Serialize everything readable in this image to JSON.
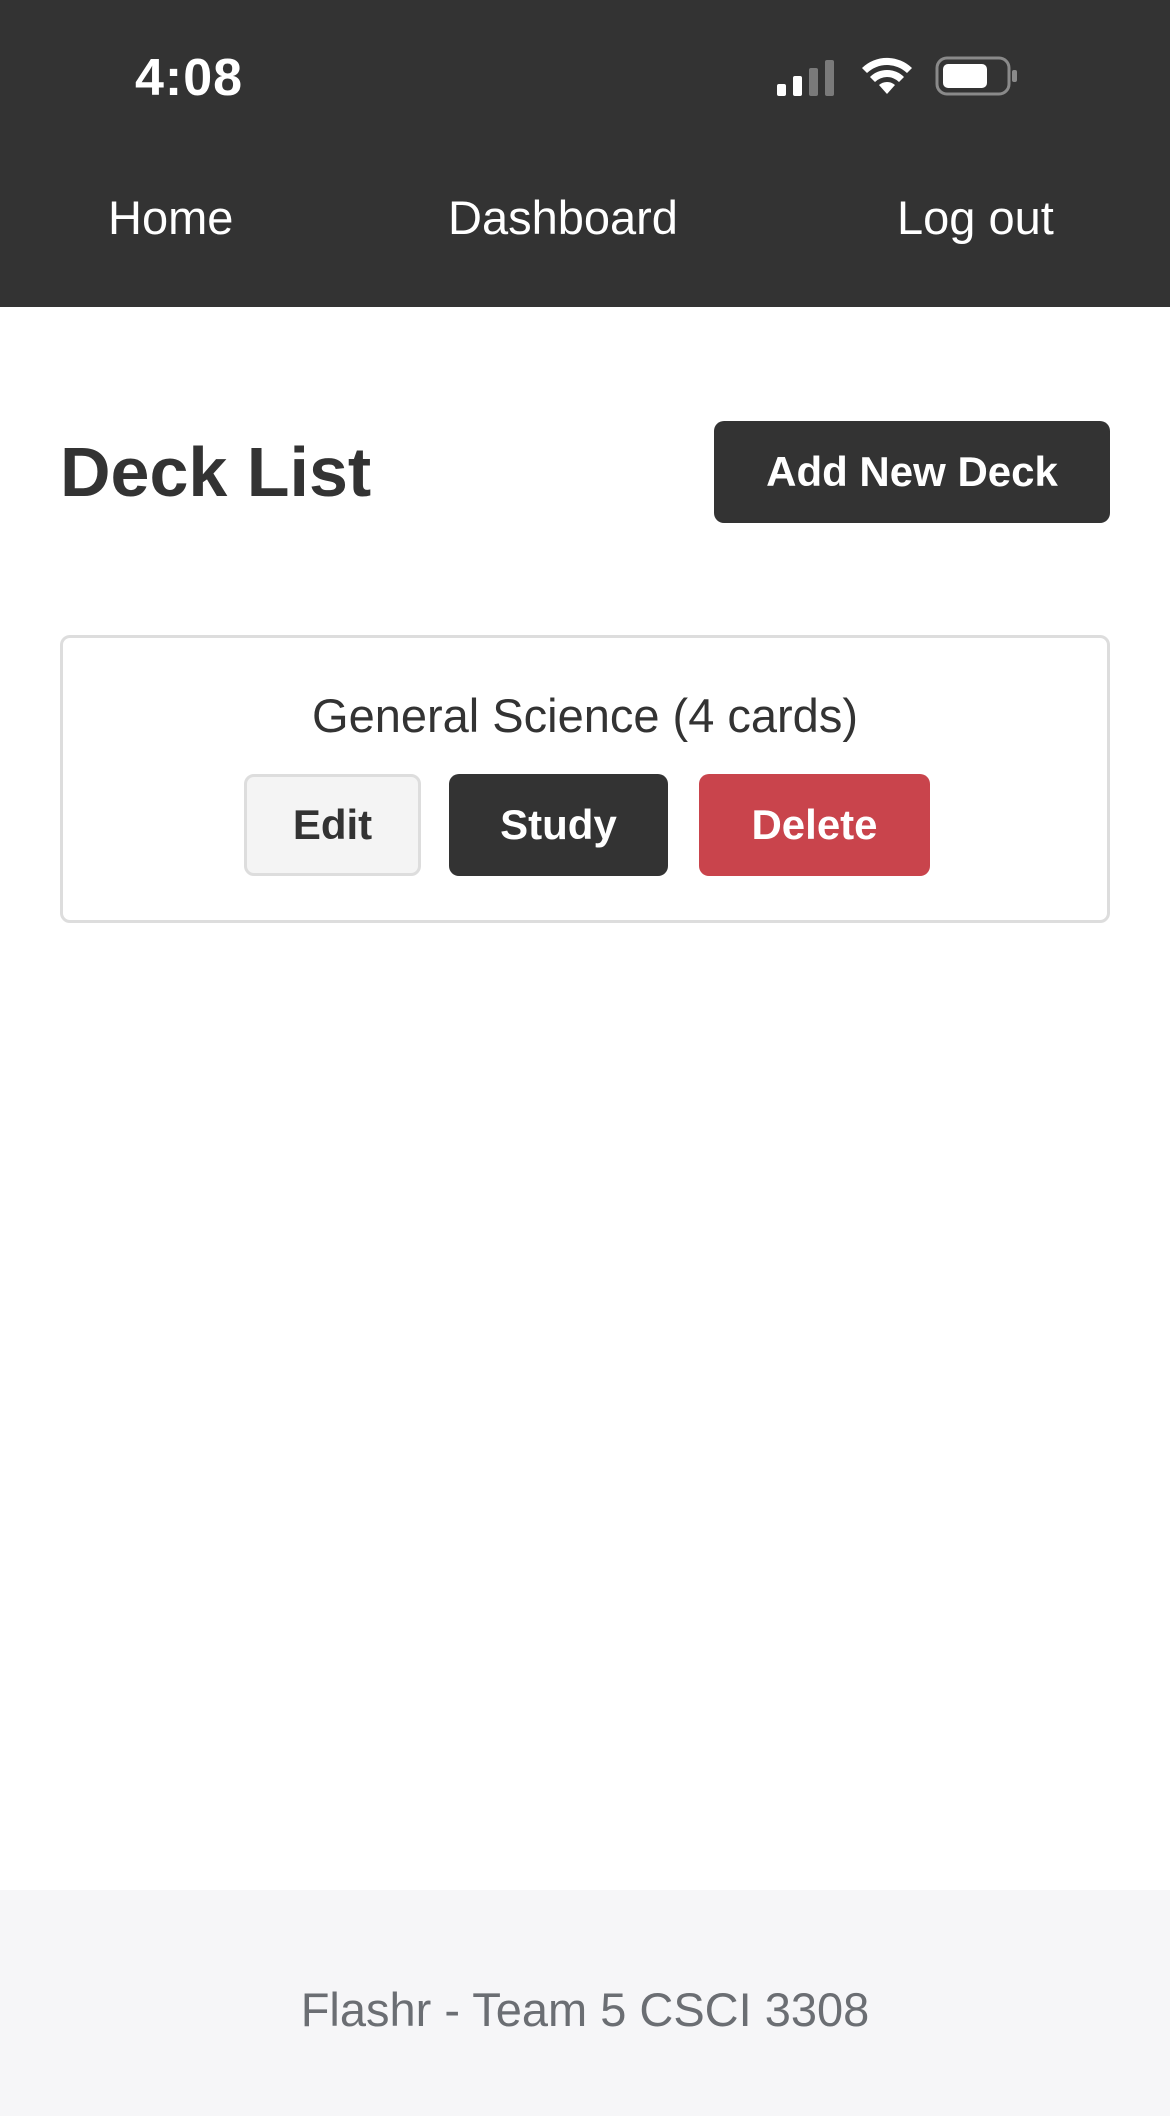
{
  "status_bar": {
    "time": "4:08",
    "icons": [
      "cellular-signal-icon",
      "wifi-icon",
      "battery-icon"
    ]
  },
  "nav": {
    "home": "Home",
    "dashboard": "Dashboard",
    "logout": "Log out"
  },
  "main": {
    "title": "Deck List",
    "add_button": "Add New Deck",
    "decks": [
      {
        "title": "General Science (4 cards)",
        "edit": "Edit",
        "study": "Study",
        "delete": "Delete"
      }
    ]
  },
  "footer": {
    "text": "Flashr - Team 5 CSCI 3308"
  },
  "colors": {
    "header_bg": "#333333",
    "primary_button": "#333333",
    "danger_button": "#c9444c",
    "secondary_button": "#f4f4f4",
    "footer_bg": "#f6f6f8"
  }
}
